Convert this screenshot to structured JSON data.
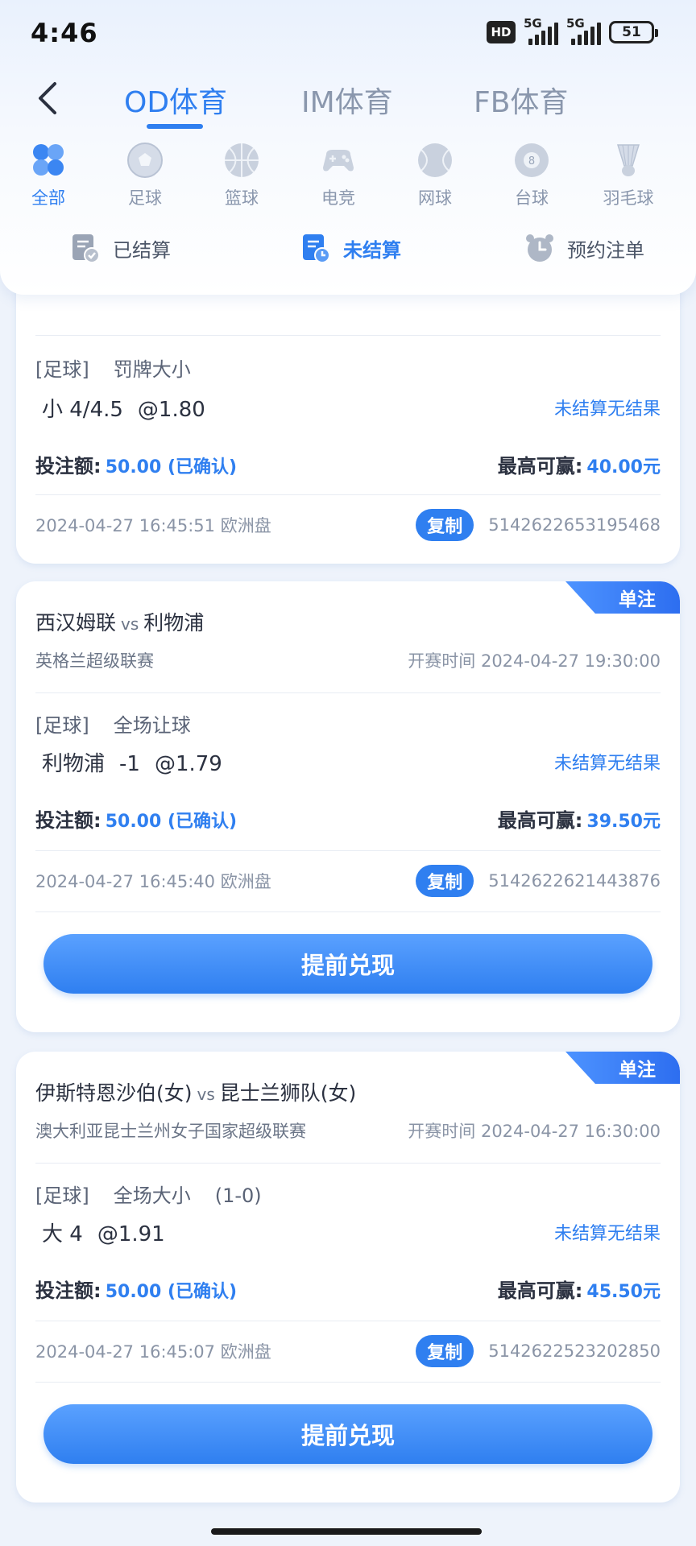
{
  "status": {
    "time": "4:46",
    "hd": "HD",
    "net1": "5G",
    "net2": "5G",
    "battery": "51"
  },
  "nav": {
    "tabs": [
      "OD体育",
      "IM体育",
      "FB体育"
    ]
  },
  "sports": [
    "全部",
    "足球",
    "篮球",
    "电竞",
    "网球",
    "台球",
    "羽毛球"
  ],
  "filters": [
    "已结算",
    "未结算",
    "预约注单"
  ],
  "labels": {
    "stake": "投注额:",
    "max_win": "最高可赢:",
    "copy": "复制",
    "cashout": "提前兑现",
    "start": "开赛时间",
    "single": "单注"
  },
  "bets": [
    {
      "market": [
        "[足球]",
        "罚牌大小"
      ],
      "pick": [
        "小 4/4.5",
        "@1.80"
      ],
      "status": "未结算无结果",
      "stake": "50.00 (已确认)",
      "max_win": "40.00元",
      "placed": "2024-04-27 16:45:51 欧洲盘",
      "order_no": "5142622653195468"
    },
    {
      "home": "西汉姆联",
      "vs": "vs",
      "away": "利物浦",
      "league": "英格兰超级联赛",
      "start": "2024-04-27 19:30:00",
      "market": [
        "[足球]",
        "全场让球"
      ],
      "pick": [
        "利物浦",
        "-1",
        "@1.79"
      ],
      "status": "未结算无结果",
      "stake": "50.00 (已确认)",
      "max_win": "39.50元",
      "placed": "2024-04-27 16:45:40 欧洲盘",
      "order_no": "5142622621443876"
    },
    {
      "home": "伊斯特恩沙伯(女)",
      "vs": "vs",
      "away": "昆士兰狮队(女)",
      "league": "澳大利亚昆士兰州女子国家超级联赛",
      "start": "2024-04-27 16:30:00",
      "market": [
        "[足球]",
        "全场大小",
        "(1-0)"
      ],
      "pick": [
        "大 4",
        "@1.91"
      ],
      "status": "未结算无结果",
      "stake": "50.00 (已确认)",
      "max_win": "45.50元",
      "placed": "2024-04-27 16:45:07 欧洲盘",
      "order_no": "5142622523202850"
    }
  ],
  "colors": {
    "accent": "#2f7ff0",
    "background": "#eef3fb"
  }
}
